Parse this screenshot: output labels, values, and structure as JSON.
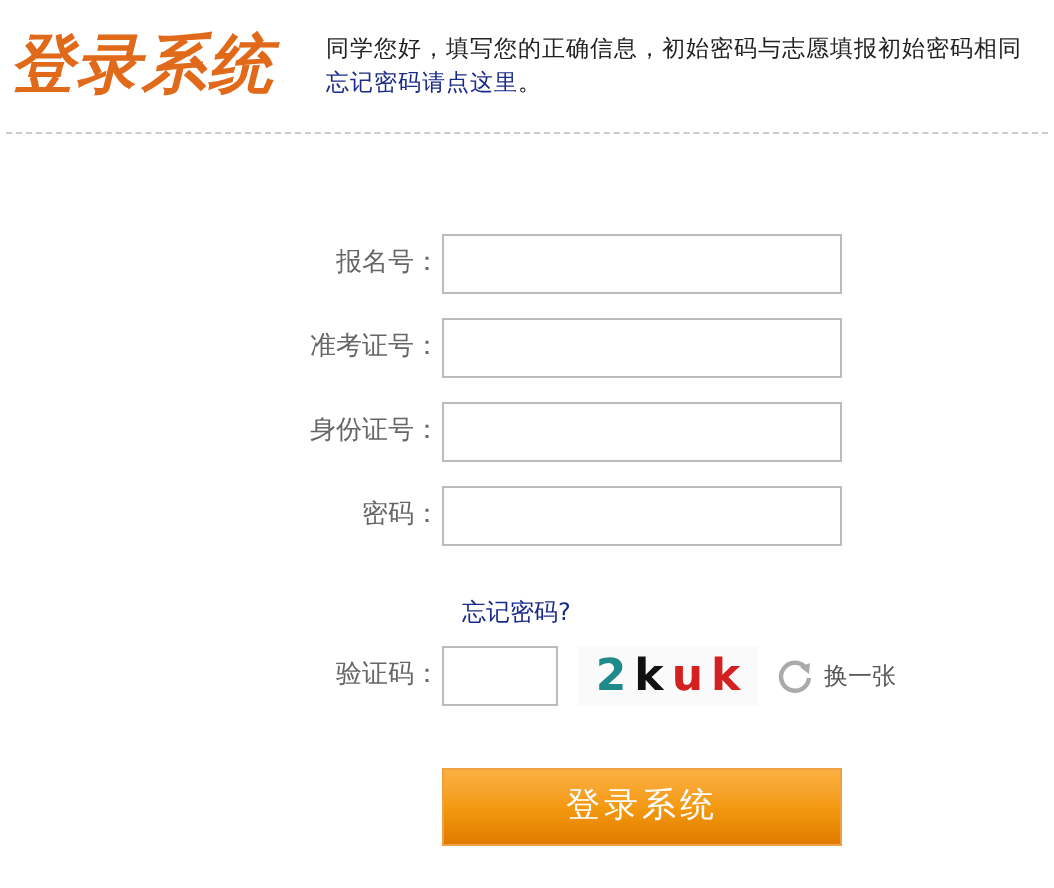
{
  "header": {
    "logo": "登录系统",
    "notice": "同学您好，填写您的正确信息，初始密码与志愿填报初始密码相同",
    "notice_link": "忘记密码请点这里",
    "notice_end": "。"
  },
  "fields": [
    {
      "label": "报名号："
    },
    {
      "label": "准考证号："
    },
    {
      "label": "身份证号："
    },
    {
      "label": "密码："
    }
  ],
  "forgot_link": "忘记密码?",
  "captcha": {
    "label": "验证码：",
    "chars": [
      {
        "text": "2",
        "color": "#1f8a8a"
      },
      {
        "text": "k",
        "color": "#111111"
      },
      {
        "text": "u",
        "color": "#d42020"
      },
      {
        "text": "k",
        "color": "#d42020"
      }
    ],
    "refresh": "换一张"
  },
  "submit": "登录系统"
}
